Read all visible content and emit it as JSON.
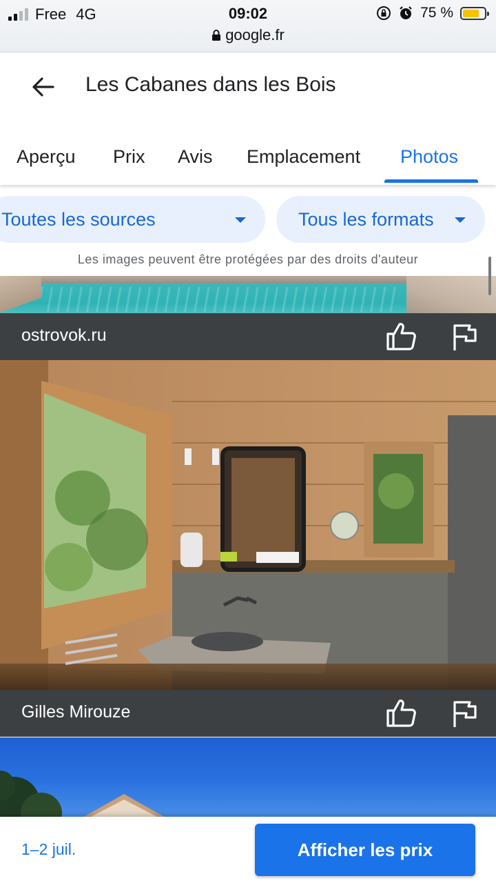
{
  "status_bar": {
    "carrier": "Free",
    "network": "4G",
    "time": "09:02",
    "battery_text": "75 %",
    "battery_level": 0.75,
    "url": "google.fr"
  },
  "header": {
    "title": "Les Cabanes dans les Bois",
    "back_icon": "arrow-left-icon"
  },
  "tabs": [
    {
      "label": "Aperçu",
      "active": false
    },
    {
      "label": "Prix",
      "active": false
    },
    {
      "label": "Avis",
      "active": false
    },
    {
      "label": "Emplacement",
      "active": false
    },
    {
      "label": "Photos",
      "active": true
    }
  ],
  "filters": {
    "source": "Toutes les sources",
    "format": "Tous les formats"
  },
  "notice": "Les images peuvent être protégées par des droits d'auteur",
  "photos": [
    {
      "description_icon": "pool-photo",
      "source": "ostrovok.ru"
    },
    {
      "description_icon": "bathroom-photo",
      "source": "Gilles Mirouze"
    },
    {
      "description_icon": "house-sky-photo",
      "source": ""
    }
  ],
  "bottom_bar": {
    "dates": "1–2 juil.",
    "cta": "Afficher les prix"
  },
  "colors": {
    "accent": "#1a73e8",
    "chip_bg": "#e8f0fe",
    "caption_bg": "#3c4043"
  }
}
